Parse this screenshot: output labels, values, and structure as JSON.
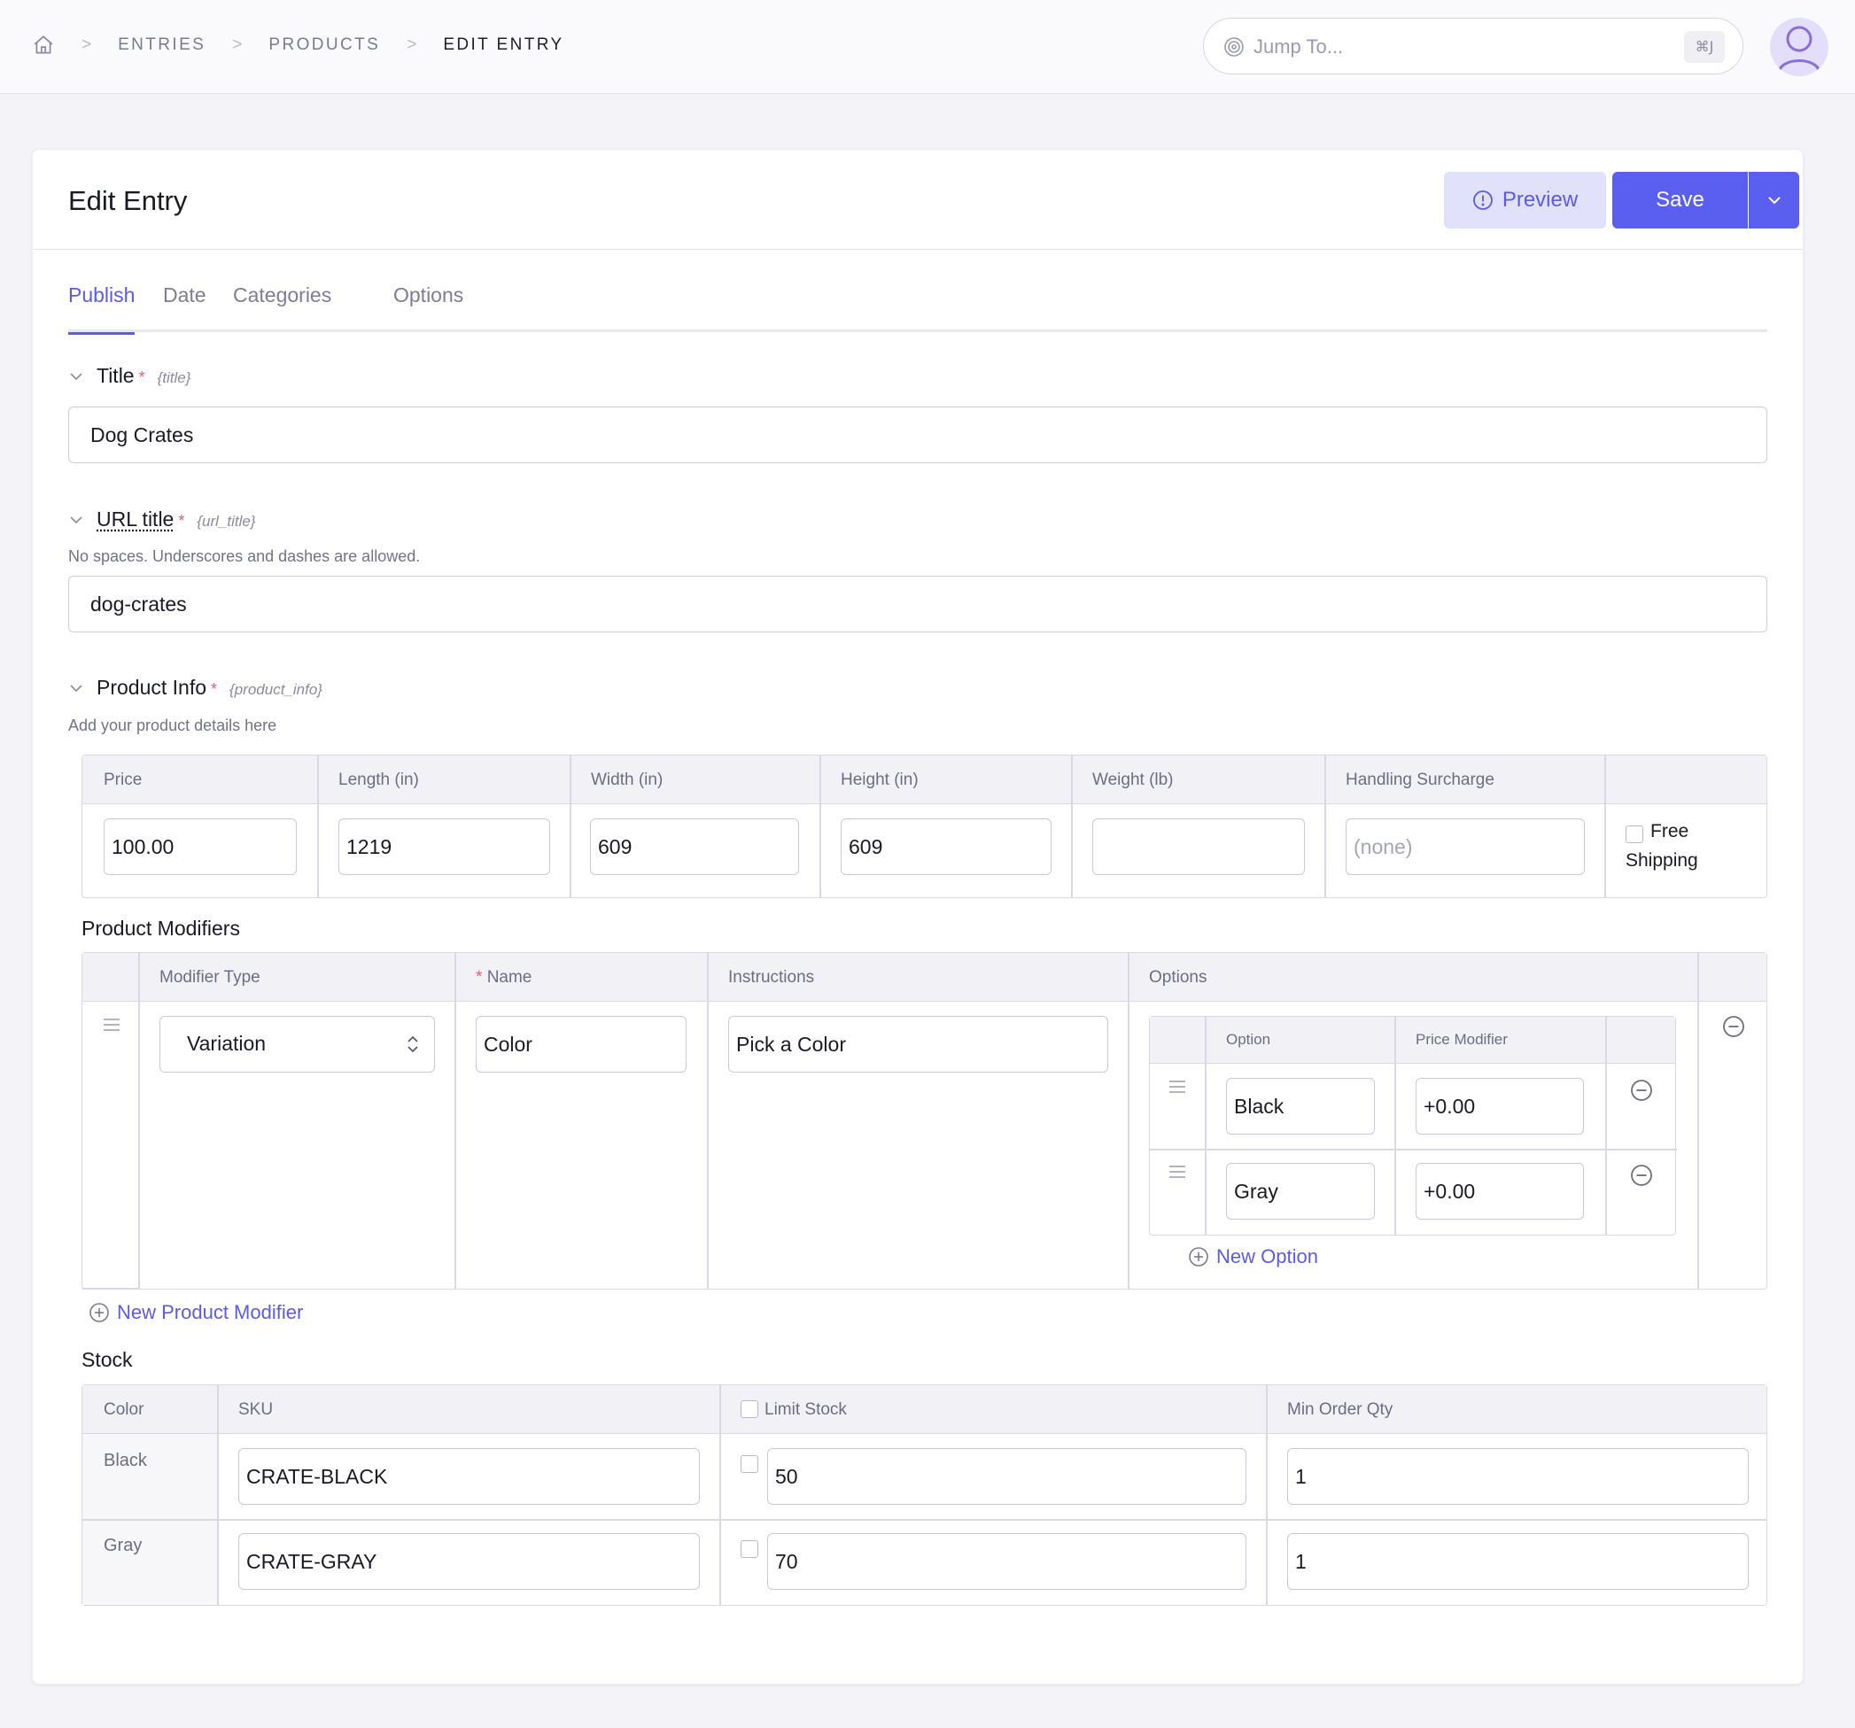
{
  "breadcrumb": {
    "items": [
      {
        "label": "ENTRIES"
      },
      {
        "label": "PRODUCTS"
      },
      {
        "label": "EDIT ENTRY"
      }
    ],
    "separator": ">"
  },
  "jump": {
    "placeholder": "Jump To...",
    "shortcut": "⌘J"
  },
  "header": {
    "title": "Edit Entry",
    "preview_label": "Preview",
    "save_label": "Save"
  },
  "tabs": [
    {
      "label": "Publish",
      "active": true
    },
    {
      "label": "Date"
    },
    {
      "label": "Categories"
    },
    {
      "label": "Options"
    }
  ],
  "fields": {
    "title": {
      "label": "Title",
      "required": "*",
      "shortname": "{title}",
      "value": "Dog Crates"
    },
    "url_title": {
      "label": "URL title",
      "required": "*",
      "shortname": "{url_title}",
      "help": "No spaces. Underscores and dashes are allowed.",
      "value": "dog-crates"
    },
    "product_info": {
      "label": "Product Info",
      "required": "*",
      "shortname": "{product_info}",
      "help": "Add your product details here"
    }
  },
  "product_info": {
    "columns": [
      "Price",
      "Length (in)",
      "Width (in)",
      "Height (in)",
      "Weight (lb)",
      "Handling Surcharge"
    ],
    "values": {
      "price": "100.00",
      "length": "1219",
      "width": "609",
      "height": "609",
      "weight": "",
      "handling": ""
    },
    "handling_placeholder": "(none)",
    "free_shipping_line1": "Free",
    "free_shipping_line2": "Shipping"
  },
  "modifiers": {
    "title": "Product Modifiers",
    "columns": {
      "type": "Modifier Type",
      "name_req": "*",
      "name": "Name",
      "instructions": "Instructions",
      "options": "Options"
    },
    "row": {
      "type": "Variation",
      "name": "Color",
      "instructions": "Pick a Color",
      "option_columns": {
        "option": "Option",
        "price": "Price Modifier"
      },
      "options": [
        {
          "option": "Black",
          "price": "+0.00"
        },
        {
          "option": "Gray",
          "price": "+0.00"
        }
      ],
      "new_option": "New Option"
    },
    "new_modifier": "New Product Modifier"
  },
  "stock": {
    "title": "Stock",
    "columns": {
      "color": "Color",
      "sku": "SKU",
      "limit": "Limit Stock",
      "min": "Min Order Qty"
    },
    "rows": [
      {
        "color": "Black",
        "sku": "CRATE-BLACK",
        "limit": "50",
        "min": "1"
      },
      {
        "color": "Gray",
        "sku": "CRATE-GRAY",
        "limit": "70",
        "min": "1"
      }
    ]
  },
  "colors": {
    "accent": "#5b5ff0",
    "accent_light": "#e1e1fb",
    "required": "#ef5b6b"
  },
  "icons": [
    "home-icon",
    "jump-icon",
    "avatar-icon",
    "info-icon",
    "chevron-down-icon",
    "drag-handle-icon",
    "minus-circle-icon",
    "plus-circle-icon",
    "select-arrows-icon"
  ]
}
